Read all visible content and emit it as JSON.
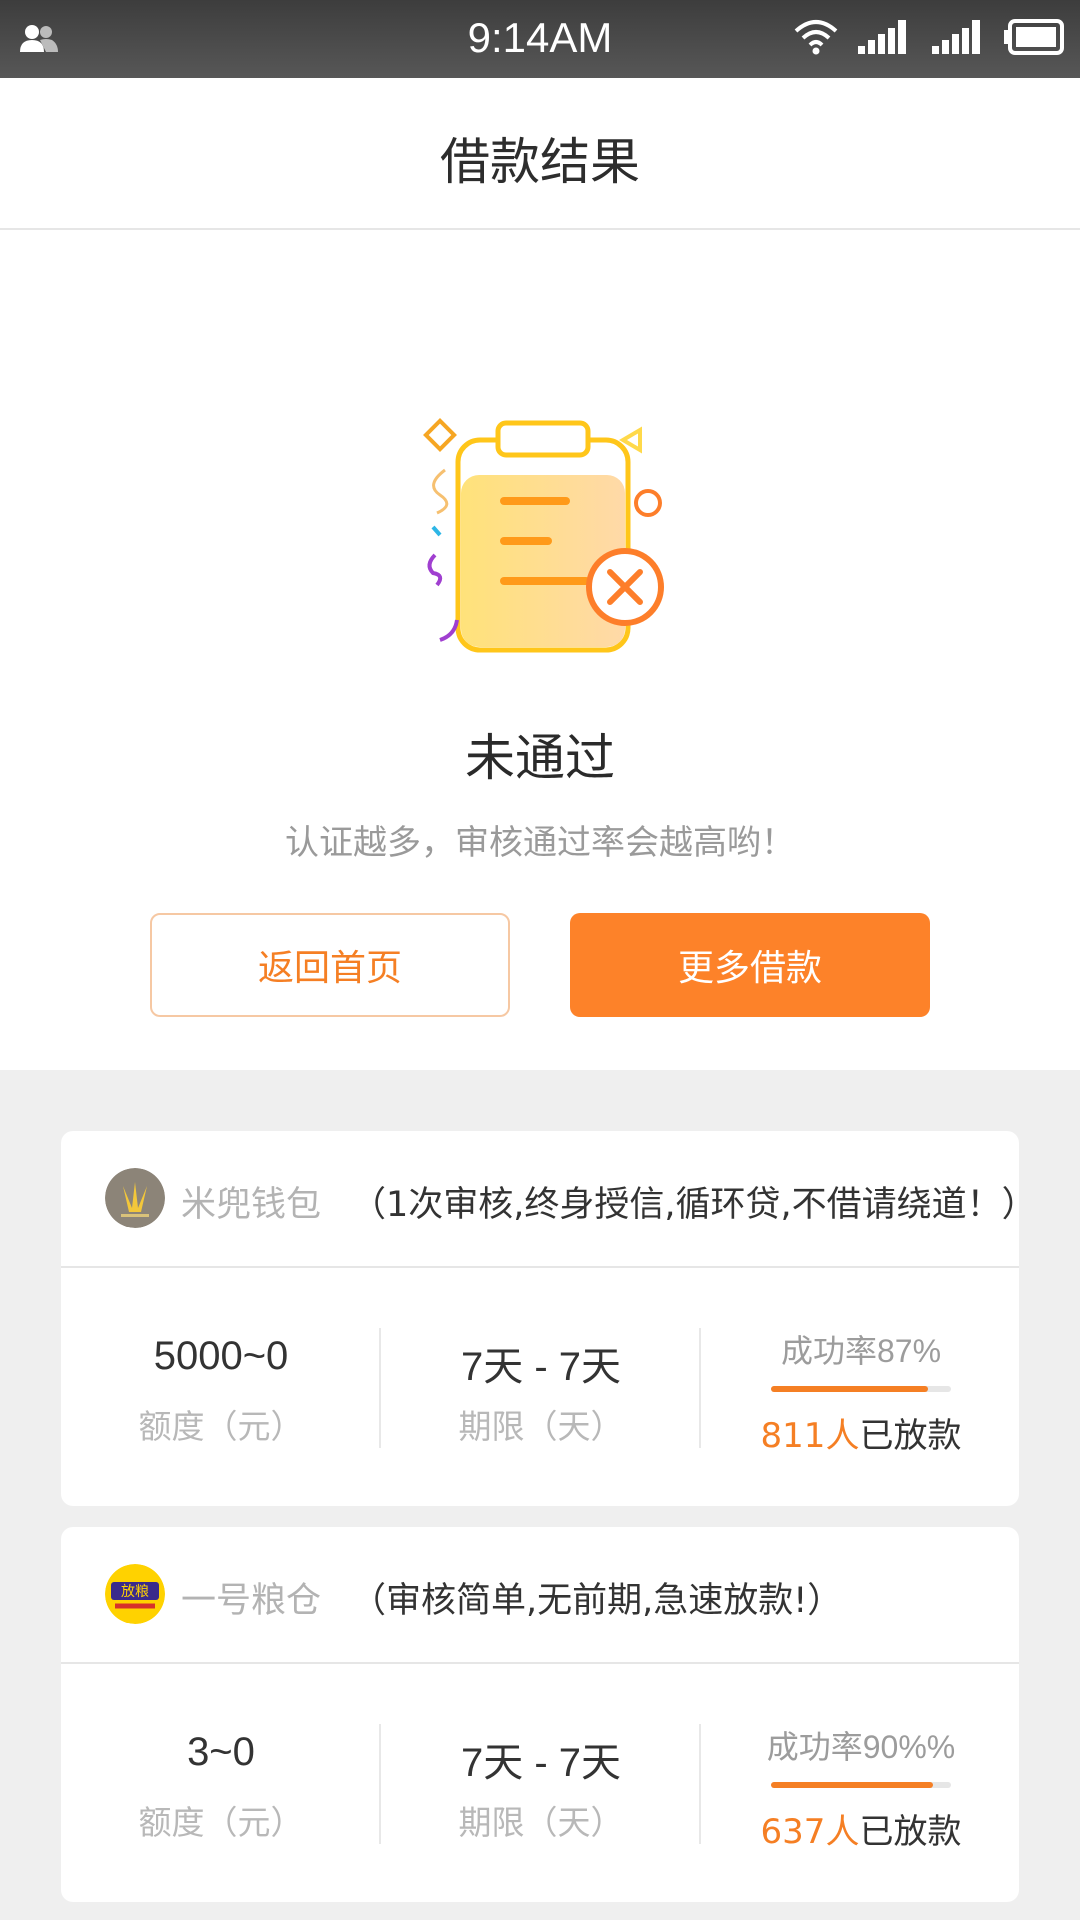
{
  "status_bar": {
    "time": "9:14AM"
  },
  "header": {
    "title": "借款结果"
  },
  "result": {
    "status": "未通过",
    "hint": "认证越多，审核通过率会越高哟！",
    "back_button": "返回首页",
    "more_button": "更多借款"
  },
  "products": [
    {
      "name": "米兜钱包",
      "slogan": "（1次审核,终身授信,循环贷,不借请绕道！）",
      "amount": "5000~0",
      "amount_label": "额度（元）",
      "term": "7天 - 7天",
      "term_label": "期限（天）",
      "rate_label": "成功率87%",
      "rate_fraction": 0.87,
      "lent_count": "811人",
      "lent_suffix": "已放款"
    },
    {
      "name": "一号粮仓",
      "slogan": "（审核简单,无前期,急速放款!）",
      "logo_text": "放粮",
      "amount": "3~0",
      "amount_label": "额度（元）",
      "term": "7天 - 7天",
      "term_label": "期限（天）",
      "rate_label": "成功率90%%",
      "rate_fraction": 0.9,
      "lent_count": "637人",
      "lent_suffix": "已放款"
    }
  ],
  "colors": {
    "accent": "#fd8229",
    "accent_text": "#f57f24",
    "bg": "#efefef"
  }
}
